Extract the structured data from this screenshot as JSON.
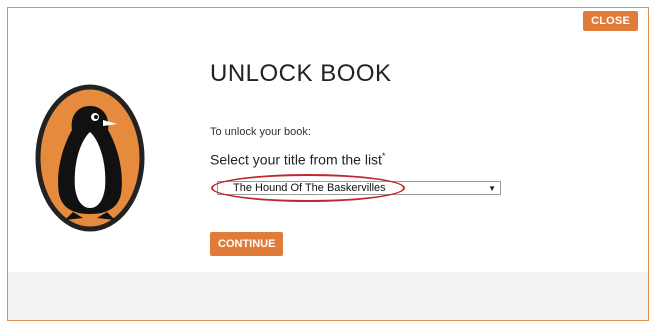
{
  "header": {
    "close_label": "CLOSE"
  },
  "dialog": {
    "title": "UNLOCK BOOK",
    "intro": "To unlock your book:",
    "select_label": "Select your title from the list",
    "required_mark": "*",
    "selected_title": "The Hound Of The Baskervilles",
    "continue_label": "CONTINUE"
  },
  "colors": {
    "accent": "#e07b39",
    "highlight_ring": "#c0282d",
    "logo_orange": "#e68a3e",
    "footer_band": "#f2f2f2"
  },
  "icons": {
    "logo": "penguin-logo-icon",
    "dropdown": "chevron-down-icon"
  }
}
